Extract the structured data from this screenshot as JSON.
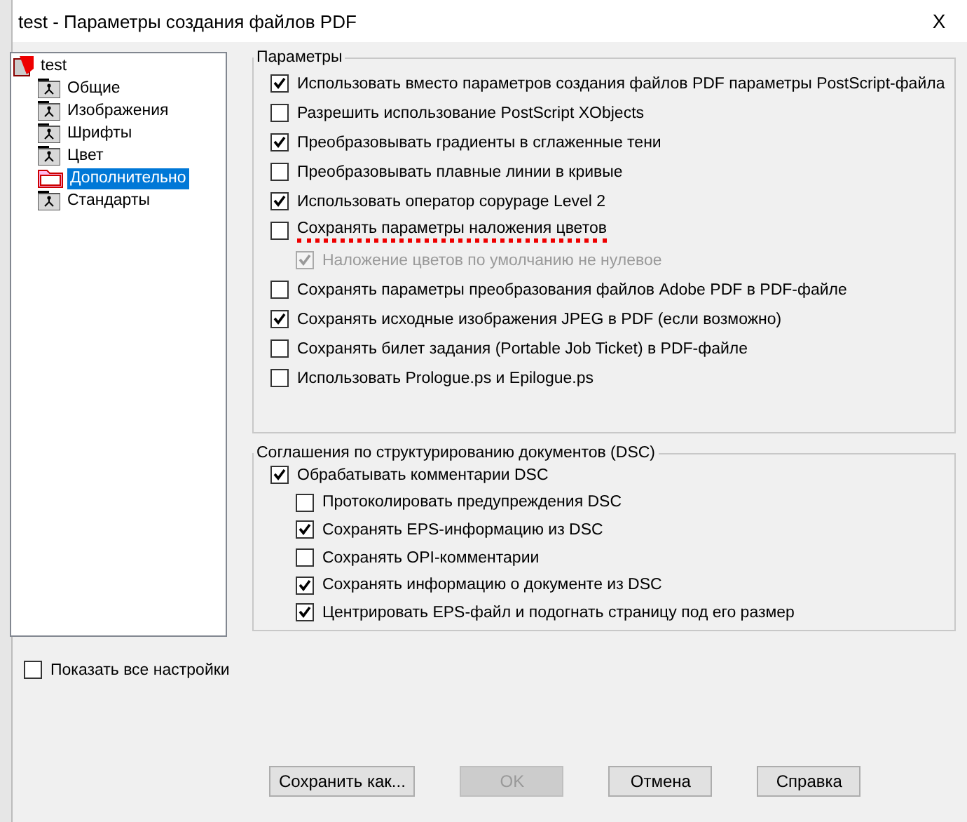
{
  "window": {
    "title": "test - Параметры создания файлов PDF",
    "close": "X"
  },
  "tree": {
    "label": "test",
    "kind": "root",
    "selected": false,
    "children": [
      {
        "label": "Общие",
        "kind": "page",
        "selected": false
      },
      {
        "label": "Изображения",
        "kind": "page",
        "selected": false
      },
      {
        "label": "Шрифты",
        "kind": "page",
        "selected": false
      },
      {
        "label": "Цвет",
        "kind": "page",
        "selected": false
      },
      {
        "label": "Дополнительно",
        "kind": "folder",
        "selected": true
      },
      {
        "label": "Стандарты",
        "kind": "page",
        "selected": false
      }
    ]
  },
  "show_all": {
    "label": "Показать все настройки",
    "checked": false
  },
  "params": {
    "title": "Параметры",
    "items": [
      {
        "label": "Использовать вместо параметров создания файлов PDF параметры PostScript-файла",
        "checked": true,
        "disabled": false,
        "flagged": false
      },
      {
        "label": "Разрешить использование PostScript XObjects",
        "checked": false,
        "disabled": false,
        "flagged": false
      },
      {
        "label": "Преобразовывать градиенты в сглаженные тени",
        "checked": true,
        "disabled": false,
        "flagged": false
      },
      {
        "label": "Преобразовывать плавные линии в кривые",
        "checked": false,
        "disabled": false,
        "flagged": false
      },
      {
        "label": "Использовать оператор copypage Level 2",
        "checked": true,
        "disabled": false,
        "flagged": false
      },
      {
        "label": "Сохранять параметры наложения цветов",
        "checked": false,
        "disabled": false,
        "flagged": true,
        "children": [
          {
            "label": "Наложение цветов по умолчанию не нулевое",
            "checked": true,
            "disabled": true,
            "flagged": false
          }
        ]
      },
      {
        "label": "Сохранять параметры преобразования файлов Adobe PDF в PDF-файле",
        "checked": false,
        "disabled": false,
        "flagged": false
      },
      {
        "label": "Сохранять исходные  изображения JPEG в PDF (если возможно)",
        "checked": true,
        "disabled": false,
        "flagged": false
      },
      {
        "label": "Сохранять билет задания (Portable Job Ticket) в PDF-файле",
        "checked": false,
        "disabled": false,
        "flagged": false
      },
      {
        "label": "Использовать Prologue.ps и Epilogue.ps",
        "checked": false,
        "disabled": false,
        "flagged": false
      }
    ]
  },
  "dsc": {
    "title": "Соглашения по структурированию документов (DSC)",
    "items": [
      {
        "label": "Обрабатывать комментарии DSC",
        "checked": true,
        "disabled": false,
        "flagged": false,
        "children": [
          {
            "label": "Протоколировать предупреждения DSC",
            "checked": false,
            "disabled": false,
            "flagged": false
          },
          {
            "label": "Сохранять EPS-информацию из DSC",
            "checked": true,
            "disabled": false,
            "flagged": false
          },
          {
            "label": "Сохранять OPI-комментарии",
            "checked": false,
            "disabled": false,
            "flagged": false
          },
          {
            "label": "Сохранять информацию о документе из DSC",
            "checked": true,
            "disabled": false,
            "flagged": false
          },
          {
            "label": "Центрировать EPS-файл и подогнать страницу под его размер",
            "checked": true,
            "disabled": false,
            "flagged": false
          }
        ]
      }
    ]
  },
  "buttons": [
    {
      "label": "Сохранить как...",
      "disabled": false
    },
    {
      "label": "OK",
      "disabled": true
    },
    {
      "label": "Отмена",
      "disabled": false
    },
    {
      "label": "Справка",
      "disabled": false
    }
  ]
}
